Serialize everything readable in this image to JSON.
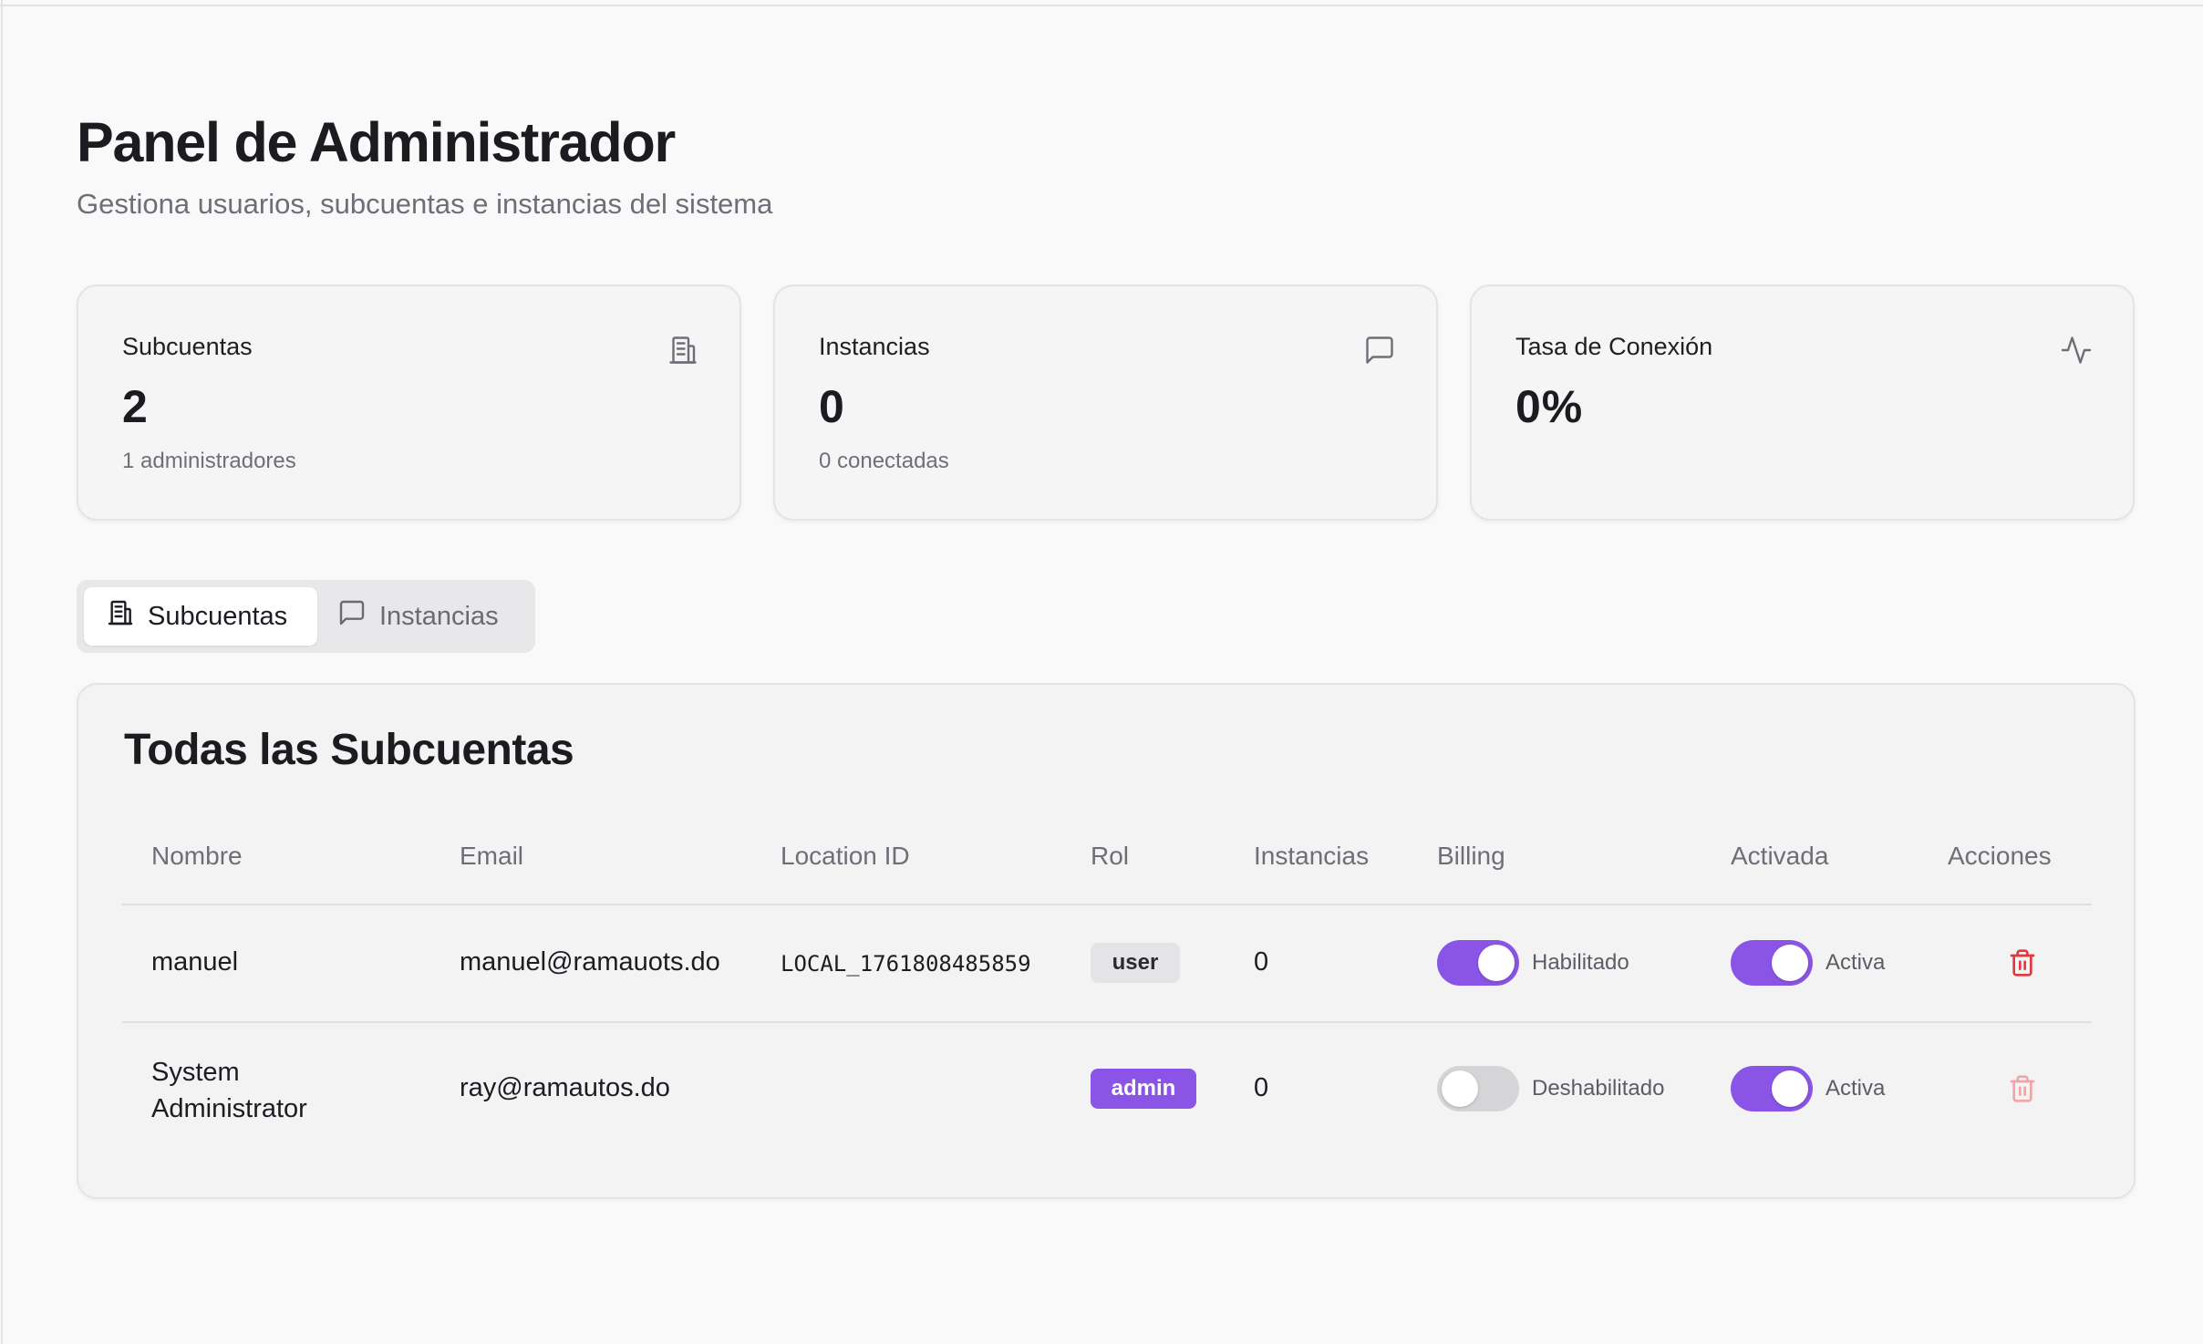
{
  "header": {
    "title": "Panel de Administrador",
    "subtitle": "Gestiona usuarios, subcuentas e instancias del sistema"
  },
  "stats": [
    {
      "label": "Subcuentas",
      "value": "2",
      "sub": "1 administradores",
      "icon": "building-icon"
    },
    {
      "label": "Instancias",
      "value": "0",
      "sub": "0 conectadas",
      "icon": "message-square-icon"
    },
    {
      "label": "Tasa de Conexión",
      "value": "0%",
      "sub": "",
      "icon": "activity-icon"
    }
  ],
  "tabs": [
    {
      "label": "Subcuentas",
      "icon": "building-icon",
      "active": true
    },
    {
      "label": "Instancias",
      "icon": "message-square-icon",
      "active": false
    }
  ],
  "table": {
    "title": "Todas las Subcuentas",
    "columns": [
      "Nombre",
      "Email",
      "Location ID",
      "Rol",
      "Instancias",
      "Billing",
      "Activada",
      "Acciones"
    ],
    "rows": [
      {
        "nombre": "manuel",
        "email": "manuel@ramauots.do",
        "location_id": "LOCAL_1761808485859",
        "rol": "user",
        "instancias": "0",
        "billing_label": "Habilitado",
        "billing_on": true,
        "activada_label": "Activa",
        "activada_on": true
      },
      {
        "nombre_line1": "System",
        "nombre_line2": "Administrator",
        "email": "ray@ramautos.do",
        "location_id": "",
        "rol": "admin",
        "instancias": "0",
        "billing_label": "Deshabilitado",
        "billing_on": false,
        "activada_label": "Activa",
        "activada_on": true
      }
    ]
  },
  "colors": {
    "accent": "#8a55e6",
    "danger": "#e0393e",
    "danger_disabled": "#f2a5a7"
  }
}
